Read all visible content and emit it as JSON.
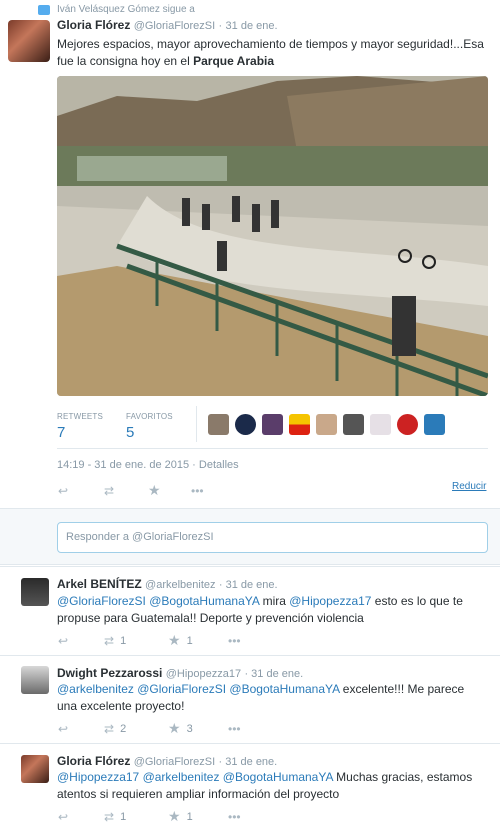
{
  "context": {
    "text": "Iván Velásquez Gómez sigue a"
  },
  "main": {
    "name": "Gloria Flórez",
    "handle": "@GloriaFlorezSI",
    "date": "31 de ene.",
    "text_pre": "Mejores espacios, mayor aprovechamiento de tiempos y mayor seguridad!...Esa fue la consigna hoy en el ",
    "text_bold": "Parque Arabia",
    "retweets_label": "RETWEETS",
    "retweets": "7",
    "favorites_label": "FAVORITOS",
    "favorites": "5",
    "timestamp": "14:19 - 31 de ene. de 2015 · Detalles",
    "reduce": "Reducir",
    "actions": {
      "more": "•••"
    }
  },
  "reply": {
    "placeholder": "Responder a @GloriaFlorezSI"
  },
  "replies": [
    {
      "name": "Arkel BENÍTEZ",
      "handle": "@arkelbenitez",
      "date": "· 31 de ene.",
      "mentions": "@GloriaFlorezSI @BogotaHumanaYA",
      "mid": " mira ",
      "mention2": "@Hipopezza17",
      "rest": " esto es lo que te propuse para Guatemala!! Deporte y prevención violencia",
      "rt": "1",
      "fav": "1"
    },
    {
      "name": "Dwight Pezzarossi",
      "handle": "@Hipopezza17",
      "date": "· 31 de ene.",
      "mentions": "@arkelbenitez @GloriaFlorezSI @BogotaHumanaYA",
      "rest": " excelente!!! Me parece una excelente proyecto!",
      "rt": "2",
      "fav": "3"
    },
    {
      "name": "Gloria Flórez",
      "handle": "@GloriaFlorezSI",
      "date": "· 31 de ene.",
      "mentions": "@Hipopezza17 @arkelbenitez @BogotaHumanaYA",
      "rest": " Muchas gracias, estamos atentos si requieren ampliar información del proyecto",
      "rt": "1",
      "fav": "1"
    }
  ],
  "colors": {
    "link": "#2b7bb9",
    "muted": "#8899a6",
    "border": "#e1e8ed"
  }
}
